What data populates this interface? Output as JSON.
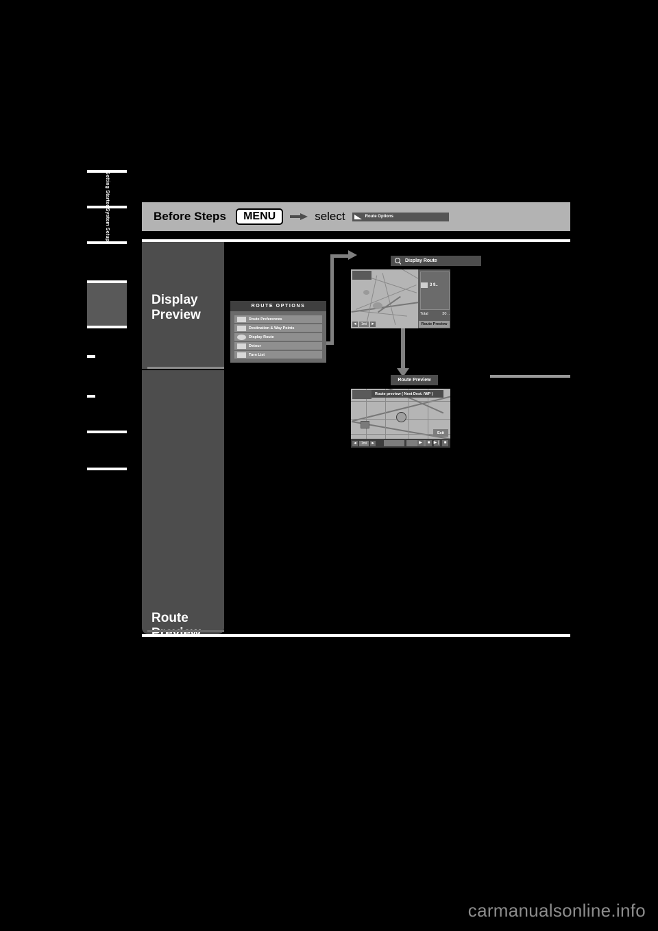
{
  "page": {
    "background_color": "#000000",
    "watermark": "carmanualsonline.info"
  },
  "side_tabs": [
    {
      "label": "Getting\nStarted"
    },
    {
      "label": "System\nSetup"
    }
  ],
  "header": {
    "title": "Before Steps",
    "menu_key": "MENU",
    "arrow": "right-arrow",
    "select_word": "select",
    "chip_label": "Route Options",
    "chip_icon": "route-icon"
  },
  "sections": [
    {
      "heading": "Display\nPreview"
    },
    {
      "heading": "Route\nPreview"
    }
  ],
  "menu": {
    "title": "ROUTE OPTIONS",
    "items": [
      {
        "label": "Route Preferences",
        "icon": "route-icon"
      },
      {
        "label": "Destination & Way Points",
        "icon": "flag-icon"
      },
      {
        "label": "Display Route",
        "icon": "magnifier-icon"
      },
      {
        "label": "Detour",
        "icon": "detour-icon"
      },
      {
        "label": "Turn List",
        "icon": "list-icon"
      }
    ]
  },
  "callouts": {
    "display_route": "Display Route",
    "route_preview": "Route Preview"
  },
  "screen_display_route": {
    "panel": {
      "arrival_value": "3 9..",
      "total_label": "Total",
      "total_value": "30 ..",
      "preview_button": "Route Preview"
    },
    "scale_label": "1mi",
    "zoom_out": "◄",
    "zoom_in": "►"
  },
  "screen_route_preview": {
    "title": "Route preview ( Next Dest. /WP )",
    "exit_button": "Exit",
    "scale_label": "1mi",
    "zoom_out": "◄",
    "zoom_in": "►",
    "controls": [
      {
        "icon": "play-icon",
        "glyph": "▶"
      },
      {
        "icon": "stop-icon",
        "glyph": "■"
      },
      {
        "icon": "skip-icon",
        "glyph": "▶❘"
      },
      {
        "icon": "stop2-icon",
        "glyph": "■"
      }
    ]
  }
}
